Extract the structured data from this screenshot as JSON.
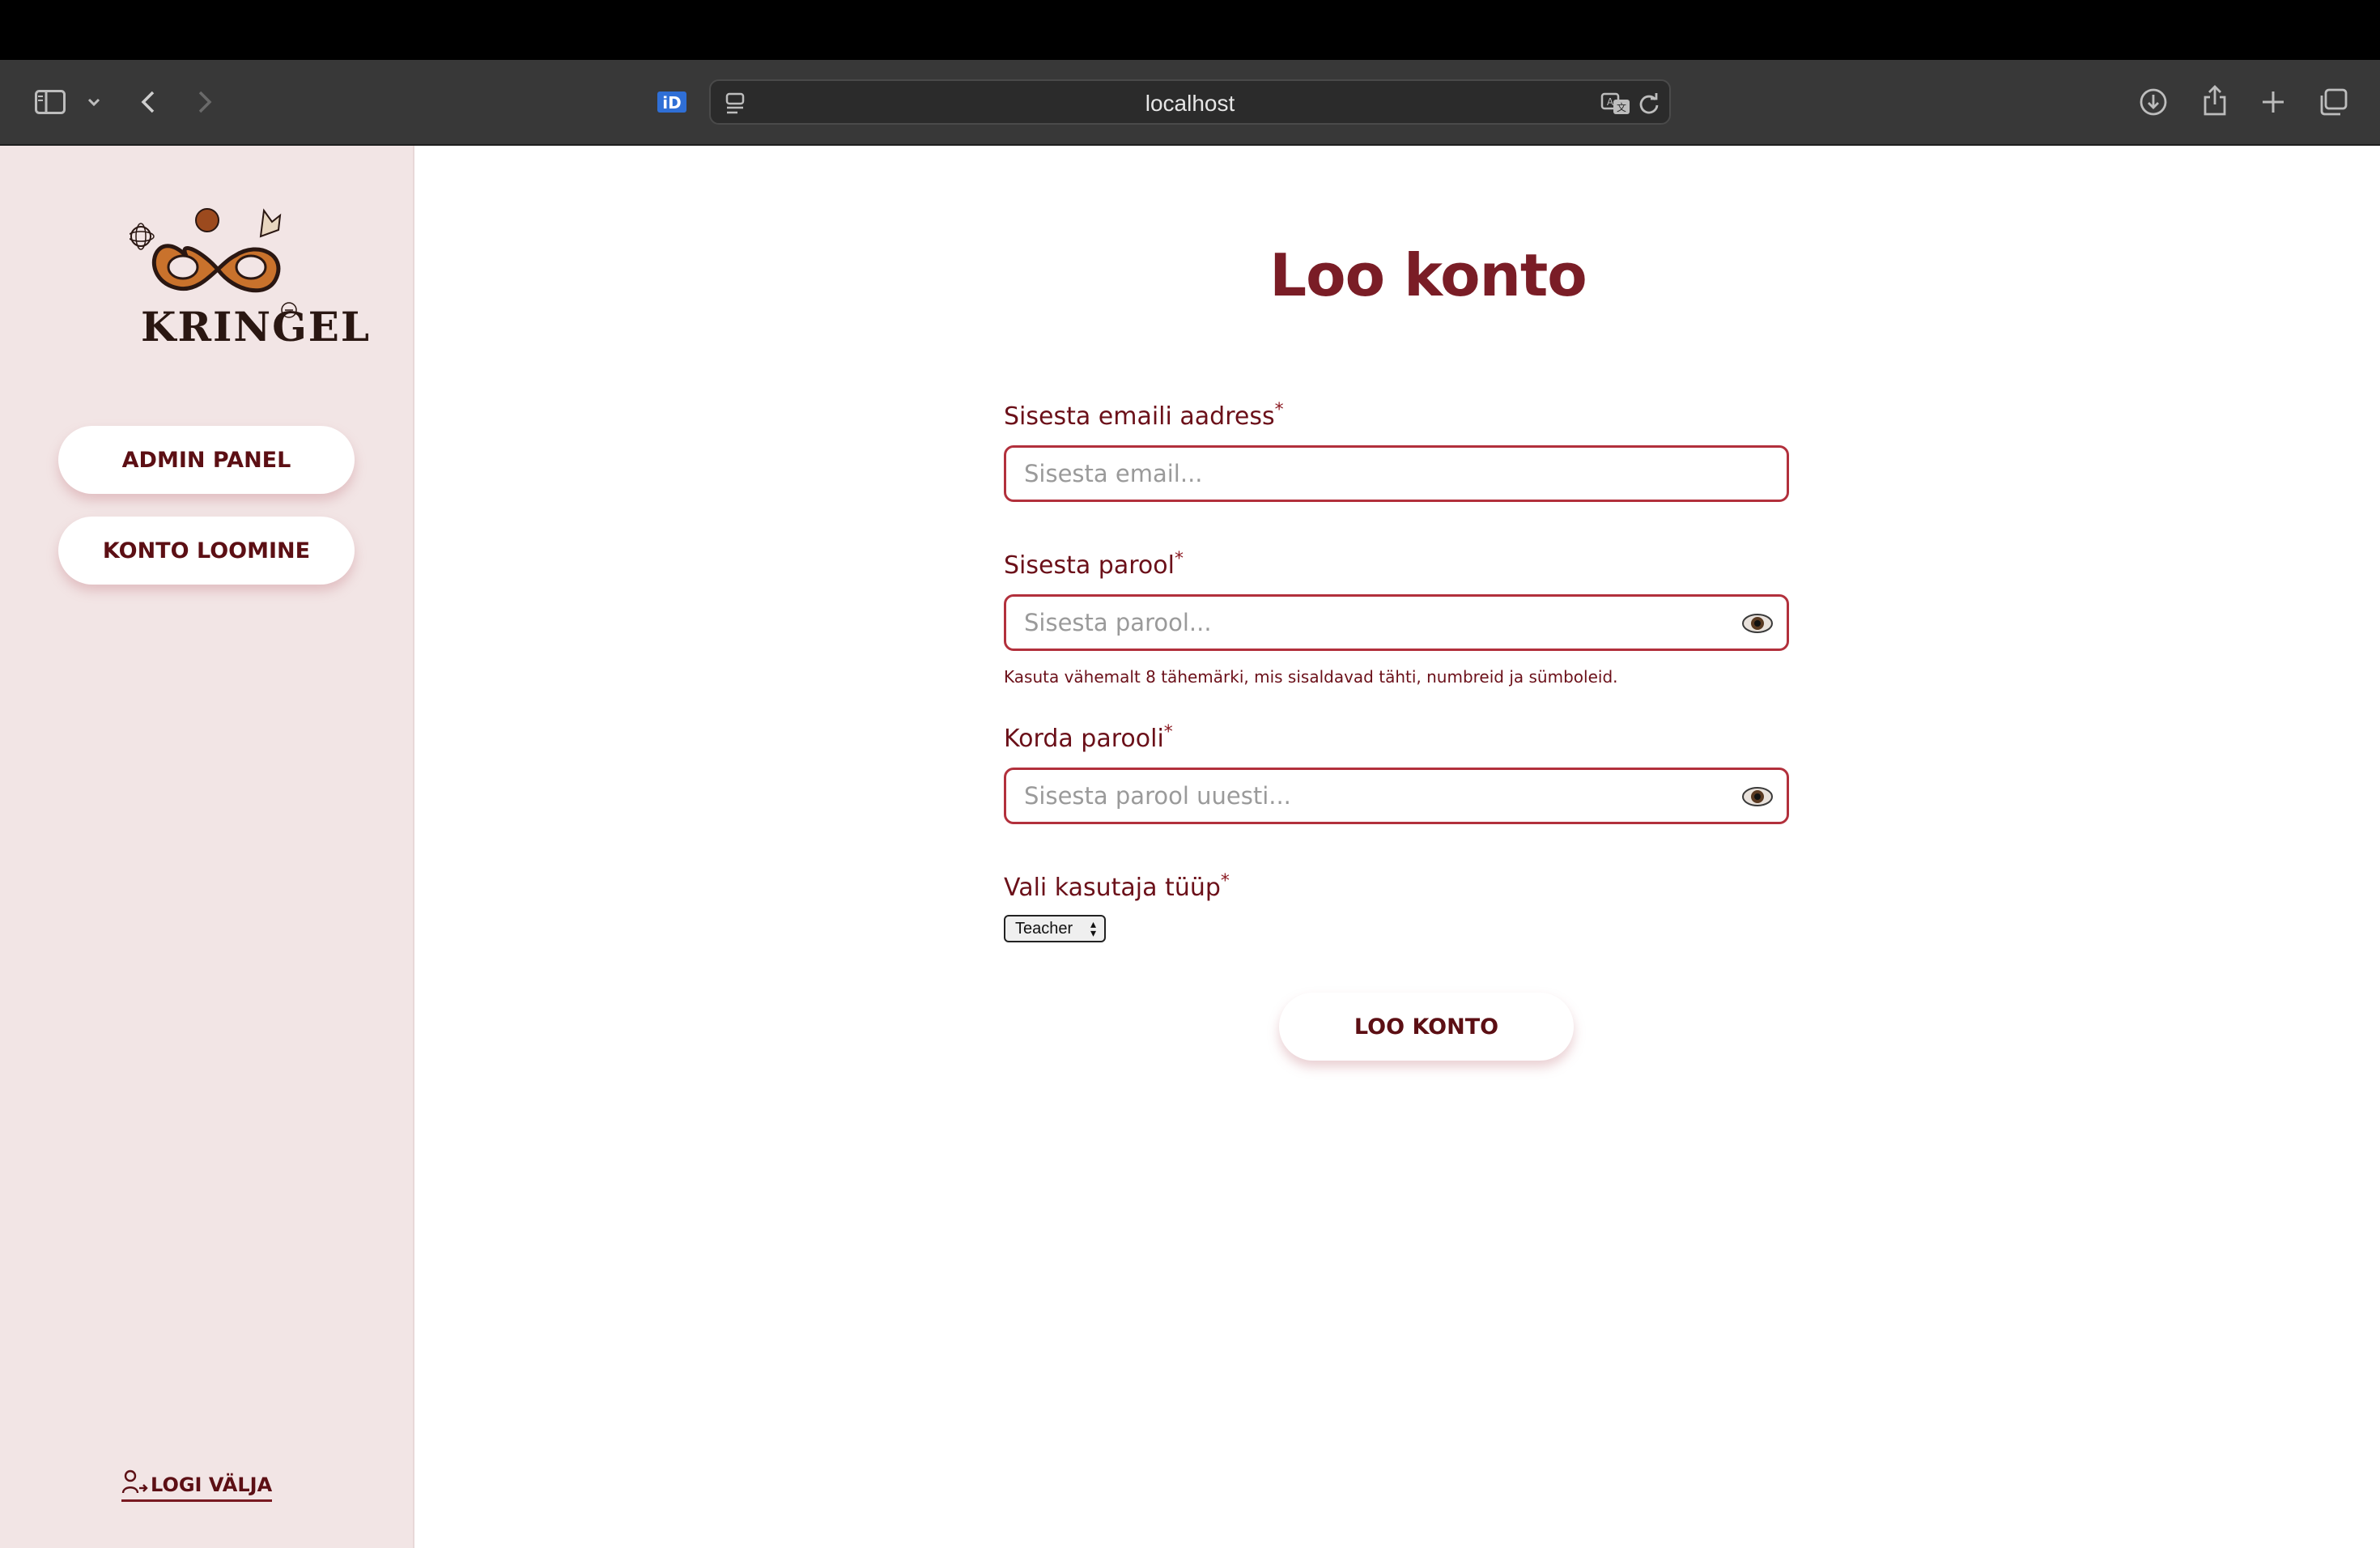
{
  "browser": {
    "url": "localhost"
  },
  "sidebar": {
    "logo_text": "KRINGEL",
    "buttons": [
      {
        "label": "ADMIN PANEL"
      },
      {
        "label": "KONTO LOOMINE"
      }
    ],
    "logout_label": "LOGI VÄLJA"
  },
  "main": {
    "title": "Loo konto",
    "email": {
      "label": "Sisesta emaili aadress",
      "required_mark": "*",
      "placeholder": "Sisesta email..."
    },
    "password": {
      "label": "Sisesta parool",
      "required_mark": "*",
      "placeholder": "Sisesta parool...",
      "hint": "Kasuta vähemalt 8 tähemärki, mis sisaldavad tähti, numbreid ja sümboleid."
    },
    "password_repeat": {
      "label": "Korda parooli",
      "required_mark": "*",
      "placeholder": "Sisesta parool uuesti..."
    },
    "user_type": {
      "label": "Vali kasutaja tüüp",
      "required_mark": "*",
      "selected": "Teacher"
    },
    "submit_label": "LOO KONTO"
  },
  "colors": {
    "accent": "#7a1d26",
    "sidebar_bg": "#f2e5e5",
    "input_border": "#b2303c"
  }
}
